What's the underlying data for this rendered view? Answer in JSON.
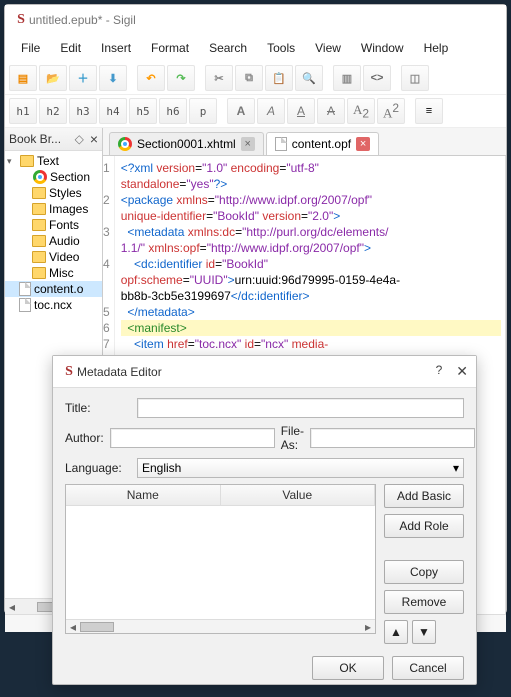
{
  "window": {
    "title": "untitled.epub* - Sigil"
  },
  "menu": {
    "items": [
      "File",
      "Edit",
      "Insert",
      "Format",
      "Search",
      "Tools",
      "View",
      "Window",
      "Help"
    ]
  },
  "book_browser": {
    "title": "Book Br...",
    "tree": [
      {
        "label": "Text",
        "type": "folder",
        "expanded": true
      },
      {
        "label": "Section",
        "type": "chrome",
        "indent": 2
      },
      {
        "label": "Styles",
        "type": "folder",
        "indent": 1
      },
      {
        "label": "Images",
        "type": "folder",
        "indent": 1
      },
      {
        "label": "Fonts",
        "type": "folder",
        "indent": 1
      },
      {
        "label": "Audio",
        "type": "folder",
        "indent": 1
      },
      {
        "label": "Video",
        "type": "folder",
        "indent": 1
      },
      {
        "label": "Misc",
        "type": "folder",
        "indent": 1
      },
      {
        "label": "content.o",
        "type": "file",
        "indent": 1,
        "selected": true
      },
      {
        "label": "toc.ncx",
        "type": "file",
        "indent": 1
      }
    ]
  },
  "tabs": [
    {
      "label": "Section0001.xhtml",
      "icon": "chrome",
      "active": false
    },
    {
      "label": "content.opf",
      "icon": "file",
      "active": true
    }
  ],
  "code": {
    "lines": [
      "<?xml version=\"1.0\" encoding=\"utf-8\" standalone=\"yes\"?>",
      "<package xmlns=\"http://www.idpf.org/2007/opf\" unique-identifier=\"BookId\" version=\"2.0\">",
      "  <metadata xmlns:dc=\"http://purl.org/dc/elements/1.1/\" xmlns:opf=\"http://www.idpf.org/2007/opf\">",
      "    <dc:identifier id=\"BookId\" opf:scheme=\"UUID\">urn:uuid:96d79995-0159-4e4a-bb8b-3cb5e3199697</dc:identifier>",
      "  </metadata>",
      "  <manifest>",
      "    <item href=\"toc.ncx\" id=\"ncx\" media-type=\"application/x-dtbncx+xml\" />"
    ]
  },
  "dialog": {
    "title": "Metadata Editor",
    "labels": {
      "title": "Title:",
      "author": "Author:",
      "fileas": "File-As:",
      "language": "Language:"
    },
    "values": {
      "title": "",
      "author": "",
      "fileas": "",
      "language": "English"
    },
    "columns": {
      "name": "Name",
      "value": "Value"
    },
    "buttons": {
      "add_basic": "Add Basic",
      "add_role": "Add Role",
      "copy": "Copy",
      "remove": "Remove",
      "ok": "OK",
      "cancel": "Cancel"
    }
  },
  "heading_buttons": [
    "h1",
    "h2",
    "h3",
    "h4",
    "h5",
    "h6",
    "p"
  ]
}
